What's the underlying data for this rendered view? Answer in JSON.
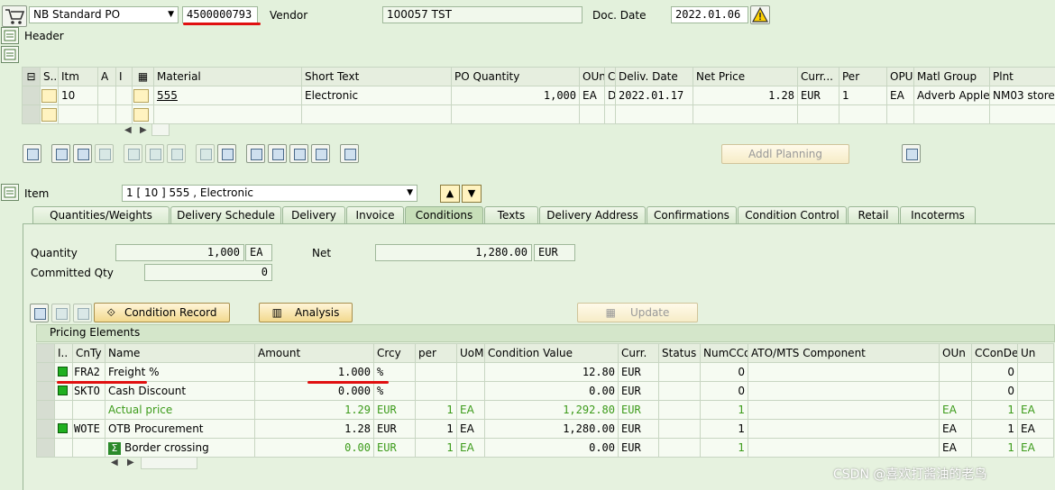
{
  "header": {
    "po_type": "NB Standard PO",
    "po_number": "4500000793",
    "vendor_label": "Vendor",
    "vendor": "100057 TST",
    "doc_date_label": "Doc. Date",
    "doc_date": "2022.01.06",
    "header_label": "Header"
  },
  "items_grid": {
    "columns": [
      "S..",
      "Itm",
      "A",
      "I",
      "Material",
      "Short Text",
      "PO Quantity",
      "OUn",
      "C",
      "Deliv. Date",
      "Net Price",
      "Curr...",
      "Per",
      "OPU",
      "Matl Group",
      "Plnt"
    ],
    "rows": [
      {
        "itm": "10",
        "a": "",
        "i": "",
        "material": "555",
        "short_text": "Electronic",
        "po_qty": "1,000",
        "oun": "EA",
        "c": "D",
        "deliv_date": "2022.01.17",
        "net_price": "1.28",
        "curr": "EUR",
        "per": "1",
        "opu": "EA",
        "matl_group": "Adverb Apple",
        "plnt": "NM03 store"
      }
    ]
  },
  "toolbar": {
    "addl_planning": "Addl Planning"
  },
  "item": {
    "label": "Item",
    "selected": "1 [ 10 ] 555 , Electronic"
  },
  "tabs": [
    "Quantities/Weights",
    "Delivery Schedule",
    "Delivery",
    "Invoice",
    "Conditions",
    "Texts",
    "Delivery Address",
    "Confirmations",
    "Condition Control",
    "Retail",
    "Incoterms"
  ],
  "conditions": {
    "qty_label": "Quantity",
    "qty": "1,000",
    "qty_unit": "EA",
    "net_label": "Net",
    "net": "1,280.00",
    "net_curr": "EUR",
    "committed_label": "Committed Qty",
    "committed": "0",
    "btn_condition_record": "Condition Record",
    "btn_analysis": "Analysis",
    "btn_update": "Update",
    "pricing_title": "Pricing Elements"
  },
  "pricing": {
    "columns": [
      "I..",
      "CnTy",
      "Name",
      "Amount",
      "Crcy",
      "per",
      "UoM",
      "Condition Value",
      "Curr.",
      "Status",
      "NumCCo",
      "ATO/MTS Component",
      "OUn",
      "CConDe",
      "Un"
    ],
    "rows": [
      {
        "cnty": "FRA2",
        "name": "Freight %",
        "amount": "1.000",
        "crcy": "%",
        "per": "",
        "uom": "",
        "cond_value": "12.80",
        "curr": "EUR",
        "status": "",
        "numcco": "0",
        "ato": "",
        "oun": "",
        "ccon": "0",
        "un": ""
      },
      {
        "cnty": "SKTO",
        "name": "Cash Discount",
        "amount": "0.000",
        "crcy": "%",
        "per": "",
        "uom": "",
        "cond_value": "0.00",
        "curr": "EUR",
        "status": "",
        "numcco": "0",
        "ato": "",
        "oun": "",
        "ccon": "0",
        "un": ""
      },
      {
        "cnty": "",
        "name": "Actual price",
        "amount": "1.29",
        "crcy": "EUR",
        "per": "1",
        "uom": "EA",
        "cond_value": "1,292.80",
        "curr": "EUR",
        "status": "",
        "numcco": "1",
        "ato": "",
        "oun": "EA",
        "ccon": "1",
        "un": "EA"
      },
      {
        "cnty": "WOTE",
        "name": "OTB Procurement",
        "amount": "1.28",
        "crcy": "EUR",
        "per": "1",
        "uom": "EA",
        "cond_value": "1,280.00",
        "curr": "EUR",
        "status": "",
        "numcco": "1",
        "ato": "",
        "oun": "EA",
        "ccon": "1",
        "un": "EA"
      },
      {
        "cnty": "",
        "name": "Border crossing",
        "amount": "0.00",
        "crcy": "EUR",
        "per": "1",
        "uom": "EA",
        "cond_value": "0.00",
        "curr": "EUR",
        "status": "",
        "numcco": "1",
        "ato": "",
        "oun": "EA",
        "ccon": "1",
        "un": "EA"
      }
    ]
  },
  "watermark": "CSDN @喜欢打酱油的老鸟"
}
